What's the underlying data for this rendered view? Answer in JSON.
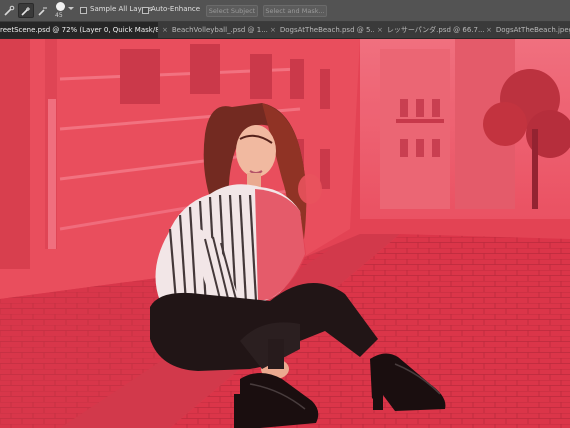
{
  "options_bar": {
    "tools": [
      {
        "name": "quick-selection-new",
        "active": false
      },
      {
        "name": "quick-selection-add",
        "active": true
      },
      {
        "name": "quick-selection-subtract",
        "active": false
      }
    ],
    "brush_size": "45",
    "sample_all_layers_label": "Sample All Layers",
    "sample_all_layers_checked": false,
    "auto_enhance_label": "Auto-Enhance",
    "auto_enhance_checked": false,
    "select_subject_label": "Select Subject",
    "select_and_mask_label": "Select and Mask..."
  },
  "tabs": [
    {
      "label": "reetScene.psd @ 72% (Layer 0, Quick Mask/8) *",
      "active": true
    },
    {
      "label": "BeachVolleyball_.psd @ 1...",
      "active": false
    },
    {
      "label": "DogsAtTheBeach.psd @ 5...",
      "active": false
    },
    {
      "label": "レッサーパンダ.psd @ 66.7...",
      "active": false
    },
    {
      "label": "DogsAtTheBeach.jpeg",
      "active": false
    }
  ],
  "canvas": {
    "quick_mask_color": "#e8404f",
    "description": "Quick Mask overlay"
  }
}
